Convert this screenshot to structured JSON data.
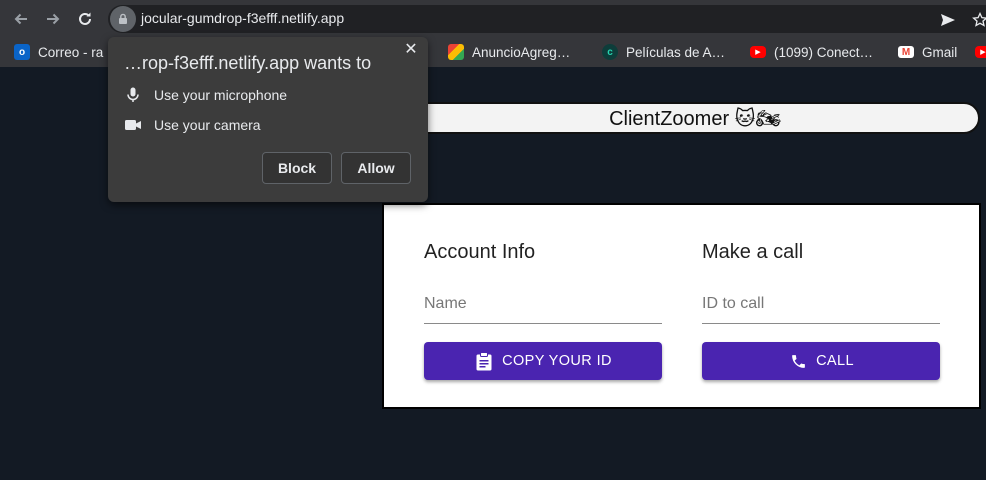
{
  "browser": {
    "url": "jocular-gumdrop-f3efff.netlify.app",
    "bookmarks": [
      {
        "label": "Correo - ra",
        "icon": "outlook-icon"
      },
      {
        "label": "AnuncioAgreg…",
        "icon": "google-drive-icon"
      },
      {
        "label": "Películas de A…",
        "icon": "site-c-icon"
      },
      {
        "label": "(1099) Conect…",
        "icon": "youtube-icon"
      },
      {
        "label": "Gmail",
        "icon": "gmail-icon"
      }
    ]
  },
  "permission_popup": {
    "title": "…rop-f3efff.netlify.app wants to",
    "items": [
      {
        "label": "Use your microphone",
        "icon": "microphone-icon"
      },
      {
        "label": "Use your camera",
        "icon": "camera-icon"
      }
    ],
    "block_label": "Block",
    "allow_label": "Allow"
  },
  "app": {
    "title": "ClientZoomer 🐱🏍",
    "account": {
      "heading": "Account Info",
      "name_placeholder": "Name",
      "copy_button": "COPY YOUR ID"
    },
    "call": {
      "heading": "Make a call",
      "id_placeholder": "ID to call",
      "call_button": "CALL"
    }
  },
  "colors": {
    "page_background": "#131a24",
    "primary_button": "#4a24b0",
    "chrome_toolbar": "#35363a"
  }
}
